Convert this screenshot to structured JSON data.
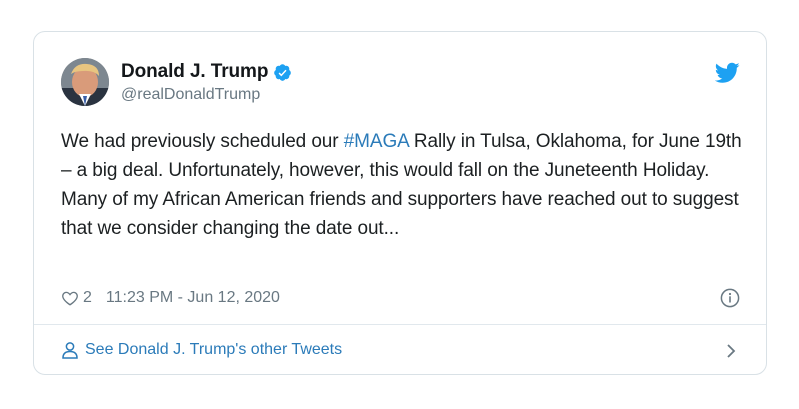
{
  "author": {
    "display_name": "Donald J. Trump",
    "handle": "@realDonaldTrump",
    "verified": true,
    "avatar_icon": "profile-photo"
  },
  "tweet": {
    "text_before": "We had previously scheduled our ",
    "hashtag": "#MAGA",
    "text_after": " Rally in Tulsa, Oklahoma, for June 19th – a big deal. Unfortunately, however, this would fall on the Juneteenth Holiday. Many of my African American friends and supporters have reached out to suggest that we consider changing the date out..."
  },
  "meta": {
    "likes": "2",
    "timestamp": "11:23 PM - Jun 12, 2020"
  },
  "footer": {
    "link_label": "See Donald J. Trump's other Tweets"
  },
  "colors": {
    "link": "#2b7bb9",
    "verified": "#1da1f2",
    "secondary_text": "#697882",
    "border": "#d9e1e6"
  },
  "icons": [
    "verified-badge-icon",
    "twitter-bird-icon",
    "heart-icon",
    "info-icon",
    "person-icon",
    "chevron-right-icon"
  ]
}
